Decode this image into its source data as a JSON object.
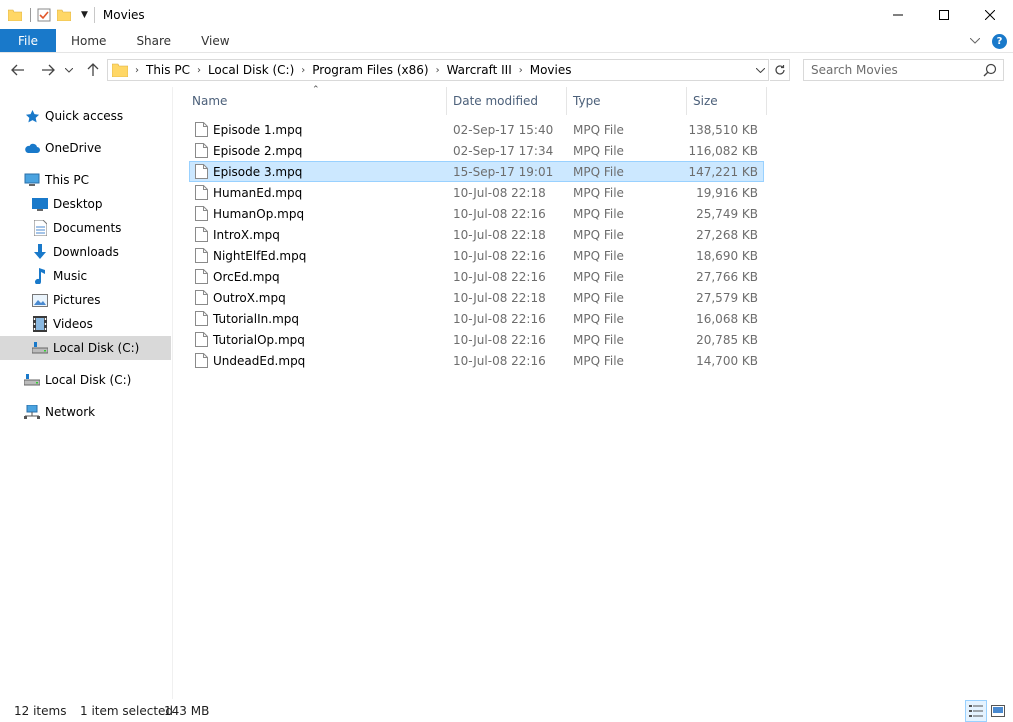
{
  "window": {
    "title": "Movies"
  },
  "ribbon": {
    "tabs": [
      "File",
      "Home",
      "Share",
      "View"
    ],
    "help": "?"
  },
  "address": {
    "crumbs": [
      "This PC",
      "Local Disk (C:)",
      "Program Files (x86)",
      "Warcraft III",
      "Movies"
    ]
  },
  "search": {
    "placeholder": "Search Movies"
  },
  "nav": {
    "items": [
      {
        "label": "Quick access",
        "icon": "star-icon"
      },
      {
        "label": "OneDrive",
        "icon": "cloud-icon"
      },
      {
        "label": "This PC",
        "icon": "computer-icon"
      },
      {
        "label": "Desktop",
        "icon": "desktop-icon"
      },
      {
        "label": "Documents",
        "icon": "documents-icon"
      },
      {
        "label": "Downloads",
        "icon": "download-icon"
      },
      {
        "label": "Music",
        "icon": "music-icon"
      },
      {
        "label": "Pictures",
        "icon": "pictures-icon"
      },
      {
        "label": "Videos",
        "icon": "videos-icon"
      },
      {
        "label": "Local Disk (C:)",
        "icon": "drive-icon"
      },
      {
        "label": "Local Disk (C:)",
        "icon": "drive-icon"
      },
      {
        "label": "Network",
        "icon": "network-icon"
      }
    ]
  },
  "columns": {
    "name": "Name",
    "date": "Date modified",
    "type": "Type",
    "size": "Size"
  },
  "files": [
    {
      "name": "Episode 1.mpq",
      "date": "02-Sep-17 15:40",
      "type": "MPQ File",
      "size": "138,510 KB"
    },
    {
      "name": "Episode 2.mpq",
      "date": "02-Sep-17 17:34",
      "type": "MPQ File",
      "size": "116,082 KB"
    },
    {
      "name": "Episode 3.mpq",
      "date": "15-Sep-17 19:01",
      "type": "MPQ File",
      "size": "147,221 KB"
    },
    {
      "name": "HumanEd.mpq",
      "date": "10-Jul-08 22:18",
      "type": "MPQ File",
      "size": "19,916 KB"
    },
    {
      "name": "HumanOp.mpq",
      "date": "10-Jul-08 22:16",
      "type": "MPQ File",
      "size": "25,749 KB"
    },
    {
      "name": "IntroX.mpq",
      "date": "10-Jul-08 22:18",
      "type": "MPQ File",
      "size": "27,268 KB"
    },
    {
      "name": "NightElfEd.mpq",
      "date": "10-Jul-08 22:16",
      "type": "MPQ File",
      "size": "18,690 KB"
    },
    {
      "name": "OrcEd.mpq",
      "date": "10-Jul-08 22:16",
      "type": "MPQ File",
      "size": "27,766 KB"
    },
    {
      "name": "OutroX.mpq",
      "date": "10-Jul-08 22:18",
      "type": "MPQ File",
      "size": "27,579 KB"
    },
    {
      "name": "TutorialIn.mpq",
      "date": "10-Jul-08 22:16",
      "type": "MPQ File",
      "size": "16,068 KB"
    },
    {
      "name": "TutorialOp.mpq",
      "date": "10-Jul-08 22:16",
      "type": "MPQ File",
      "size": "20,785 KB"
    },
    {
      "name": "UndeadEd.mpq",
      "date": "10-Jul-08 22:16",
      "type": "MPQ File",
      "size": "14,700 KB"
    }
  ],
  "status": {
    "count": "12 items",
    "selected": "1 item selected",
    "size": "143 MB"
  },
  "colors": {
    "accent": "#1979ca",
    "selection": "#cce8ff",
    "selection_border": "#99d1ff",
    "header_text": "#4c607a"
  }
}
